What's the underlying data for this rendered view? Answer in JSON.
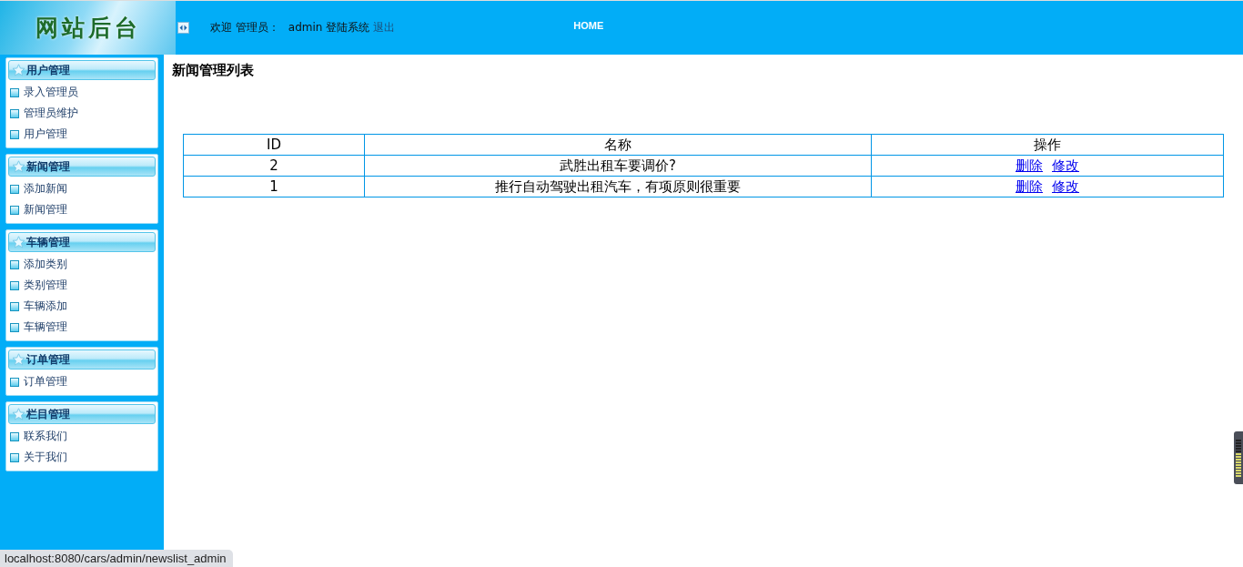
{
  "header": {
    "logo": "网站后台",
    "welcome": "欢迎 管理员：",
    "user": "admin",
    "login_text": "登陆系统",
    "logout": "退出",
    "nav": "HOME"
  },
  "sidebar": [
    {
      "title": "用户管理",
      "items": [
        "录入管理员",
        "管理员维护",
        "用户管理"
      ]
    },
    {
      "title": "新闻管理",
      "items": [
        "添加新闻",
        "新闻管理"
      ]
    },
    {
      "title": "车辆管理",
      "items": [
        "添加类别",
        "类别管理",
        "车辆添加",
        "车辆管理"
      ]
    },
    {
      "title": "订单管理",
      "items": [
        "订单管理"
      ]
    },
    {
      "title": "栏目管理",
      "items": [
        "联系我们",
        "关于我们"
      ]
    }
  ],
  "page_title": "新闻管理列表",
  "table": {
    "columns": [
      "ID",
      "名称",
      "操作"
    ],
    "rows": [
      {
        "id": "2",
        "name": "武胜出租车要调价?",
        "actions": [
          "删除",
          "修改"
        ]
      },
      {
        "id": "1",
        "name": "推行自动驾驶出租汽车，有项原则很重要",
        "actions": [
          "删除",
          "修改"
        ]
      }
    ]
  },
  "status_bar": "localhost:8080/cars/admin/newslist_admin"
}
